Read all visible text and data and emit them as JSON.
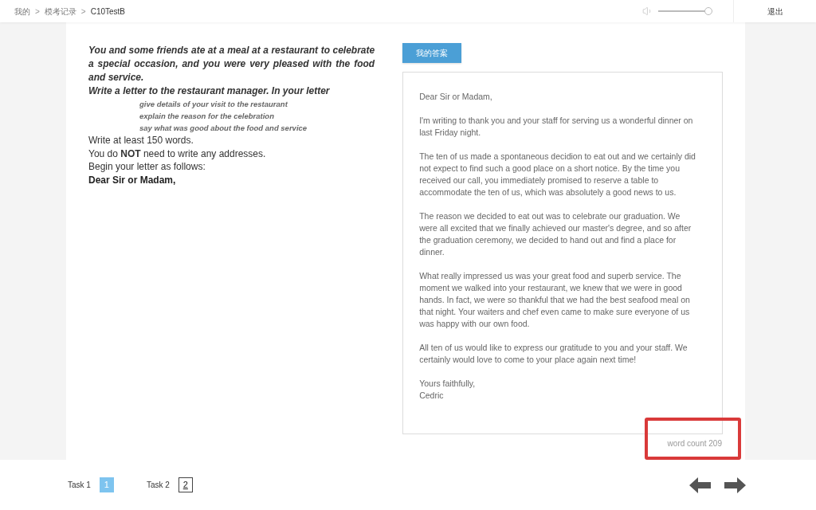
{
  "breadcrumb": [
    {
      "kind": "link",
      "label": "我的"
    },
    {
      "kind": "separator",
      "label": ">"
    },
    {
      "kind": "link",
      "label": "模考记录"
    },
    {
      "kind": "separator",
      "label": ">"
    },
    {
      "kind": "current",
      "label": "C10TestB"
    }
  ],
  "volume": {
    "level": 0.95
  },
  "exit_button": "退出",
  "prompt": {
    "paragraphs": [
      "You and some friends ate at a meal at a restaurant to celebrate a special occasion, and you were very pleased with the food and service.",
      "Write a letter to the restaurant manager. In your letter"
    ],
    "bullets": [
      "give details of your visit to the restaurant",
      "explain the reason for the celebration",
      "say what was good about the food and service"
    ],
    "instructions": [
      {
        "kind": "plain",
        "text": "Write at least 150 words."
      },
      {
        "kind": "plain",
        "text": "You do **NOT** need to write any addresses."
      },
      {
        "kind": "plain",
        "text": "Begin your letter as follows:"
      },
      {
        "kind": "emphasis",
        "text": "Dear Sir or Madam,"
      }
    ]
  },
  "answer": {
    "tab": {
      "label": "我的答案",
      "selected": true
    },
    "paragraphs": [
      "Dear Sir or Madam,",
      "I'm writing to thank you and your staff for serving us a wonderful dinner on last Friday night.",
      "The ten of us made a spontaneous decidion to eat out and we certainly did not expect to find such a good place on a short notice. By the time you received our call, you immediately promised to reserve a table to accommodate the ten of us, which was absolutely a good news to us.",
      "The reason we decided to eat out was to celebrate our graduation. We were all excited that we finally achieved our master's degree, and so after the graduation ceremony, we decided to hand out and find a place for dinner.",
      "What really impressed us was your great food and superb service. The moment we walked into your restaurant, we knew that we were in good hands. In fact, we were so thankful that we had the best seafood meal on that night. Your waiters and chef even came to make sure everyone of us was happy with our own food.",
      "All ten of us would like to express our gratitude to you and your staff. We certainly would love to come to your place again next time!"
    ],
    "closing": [
      "Yours faithfully,",
      "Cedric"
    ],
    "word_count": {
      "text": "word count 209",
      "highlighted": true
    }
  },
  "tasks": [
    {
      "label": "Task 1",
      "number": "1",
      "selected": true
    },
    {
      "label": "Task 2",
      "number": "2",
      "selected": false
    }
  ]
}
